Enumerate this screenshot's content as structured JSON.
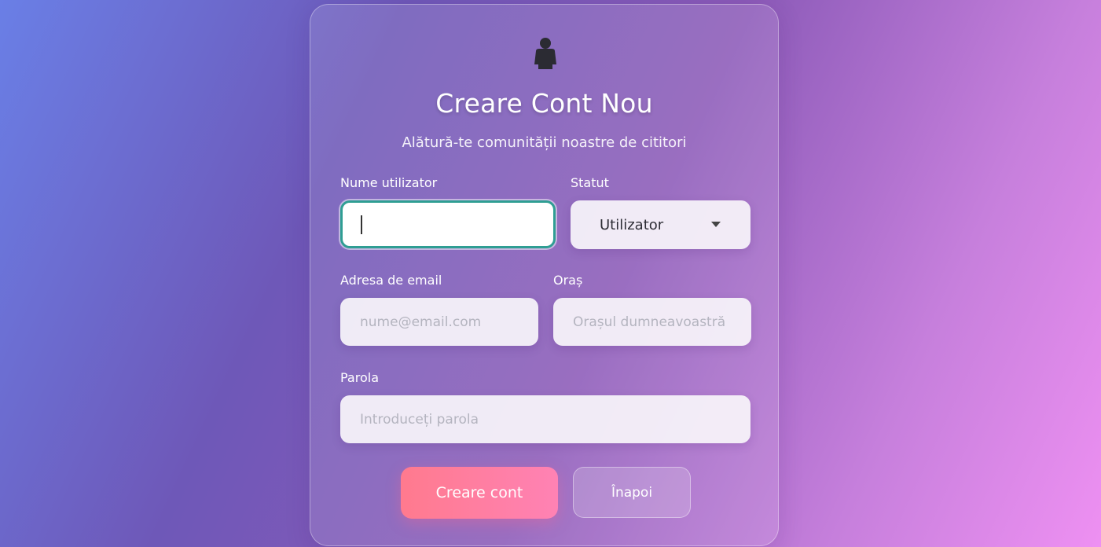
{
  "form": {
    "title": "Creare Cont Nou",
    "subtitle": "Alătură-te comunității noastre de cititori",
    "avatar_icon": "person-icon",
    "username": {
      "label": "Nume utilizator",
      "value": "",
      "placeholder": ""
    },
    "status": {
      "label": "Statut",
      "selected": "Utilizator"
    },
    "email": {
      "label": "Adresa de email",
      "placeholder": "nume@email.com"
    },
    "city": {
      "label": "Oraș",
      "placeholder": "Orașul dumneavoastră"
    },
    "password": {
      "label": "Parola",
      "placeholder": "Introduceți parola"
    },
    "submit_label": "Creare cont",
    "back_label": "Înapoi"
  },
  "colors": {
    "accent_focus": "#2f9e93",
    "primary_button_start": "#ff7a8e",
    "primary_button_end": "#ff82b4",
    "background_start": "#6a7fe6",
    "background_end": "#ee90f2"
  }
}
